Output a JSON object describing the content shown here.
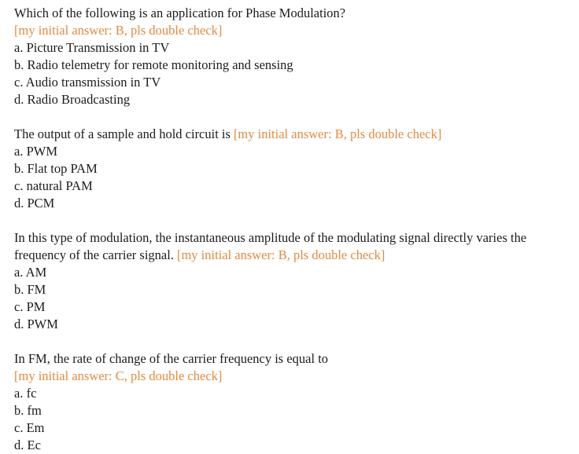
{
  "document": {
    "type": "multiple-choice-quiz",
    "text_color": "#1b1b1b",
    "annotation_color": "#e08b42",
    "background_color": "#ffffff",
    "questions": [
      {
        "stem": "Which of the following is an application for Phase Modulation?",
        "annotation": "[my initial answer: B, pls double check]",
        "annotation_placement": "block",
        "choices": [
          "a. Picture Transmission in TV",
          "b. Radio telemetry for remote monitoring and sensing",
          "c. Audio transmission in TV",
          "d. Radio Broadcasting"
        ]
      },
      {
        "stem": "The output of a sample and hold circuit is",
        "annotation": "[my initial answer: B, pls double check]",
        "annotation_placement": "inline",
        "choices": [
          "a. PWM",
          "b. Flat top PAM",
          "c. natural PAM",
          "d. PCM"
        ]
      },
      {
        "stem": "In this type of modulation, the instantaneous amplitude of the modulating signal directly varies the frequency of the carrier signal.",
        "annotation": "[my initial answer: B, pls double check]",
        "annotation_placement": "inline",
        "choices": [
          "a. AM",
          "b. FM",
          "c. PM",
          "d. PWM"
        ]
      },
      {
        "stem": "In FM, the rate of change of the carrier frequency is equal to",
        "annotation": "[my initial answer: C, pls double check]",
        "annotation_placement": "block",
        "choices": [
          "a. fc",
          "b. fm",
          "c. Em",
          "d. Ec"
        ]
      }
    ]
  }
}
